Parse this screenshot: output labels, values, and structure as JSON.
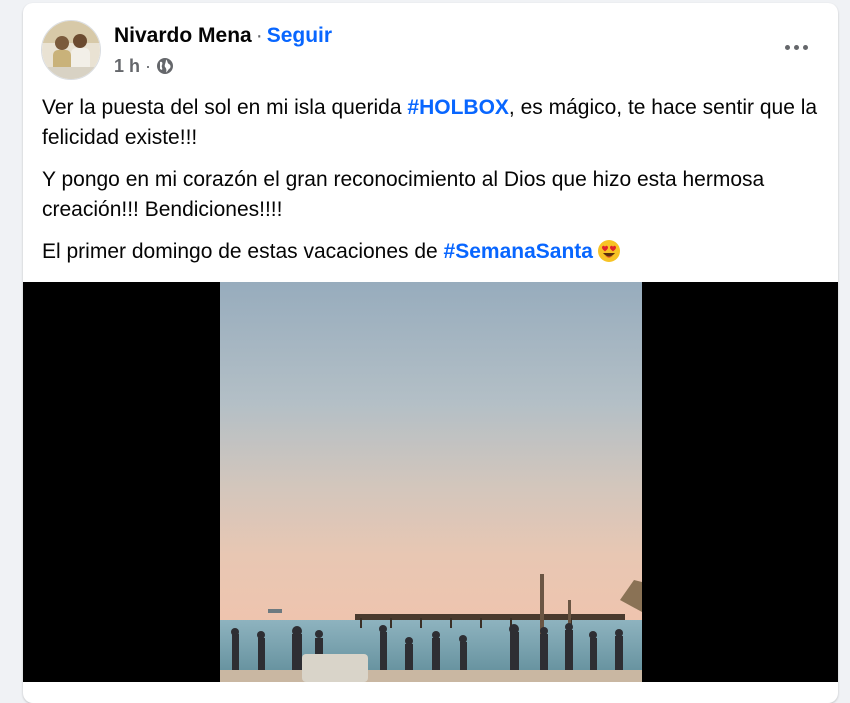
{
  "post": {
    "author": "Nivardo Mena",
    "separator": "·",
    "follow_label": "Seguir",
    "time": "1 h",
    "meta_separator": "·",
    "privacy_icon": "globe-icon",
    "more_icon": "more-options-icon",
    "paragraphs": {
      "p1": {
        "part1": "Ver la puesta del sol en mi isla querida ",
        "hashtag": "#HOLBOX",
        "part2": ", es mágico, te hace sentir que la felicidad existe!!!"
      },
      "p2": {
        "text": "Y pongo en mi corazón el gran reconocimiento al Dios que hizo esta hermosa creación!!!  Bendiciones!!!!"
      },
      "p3": {
        "part1": "El primer domingo de estas vacaciones de ",
        "hashtag": "#SemanaSanta",
        "emoji": "heart-eyes-emoji"
      }
    }
  },
  "colors": {
    "link": "#0866ff",
    "text": "#050505",
    "secondary": "#65676b",
    "media_background": "#000000"
  }
}
